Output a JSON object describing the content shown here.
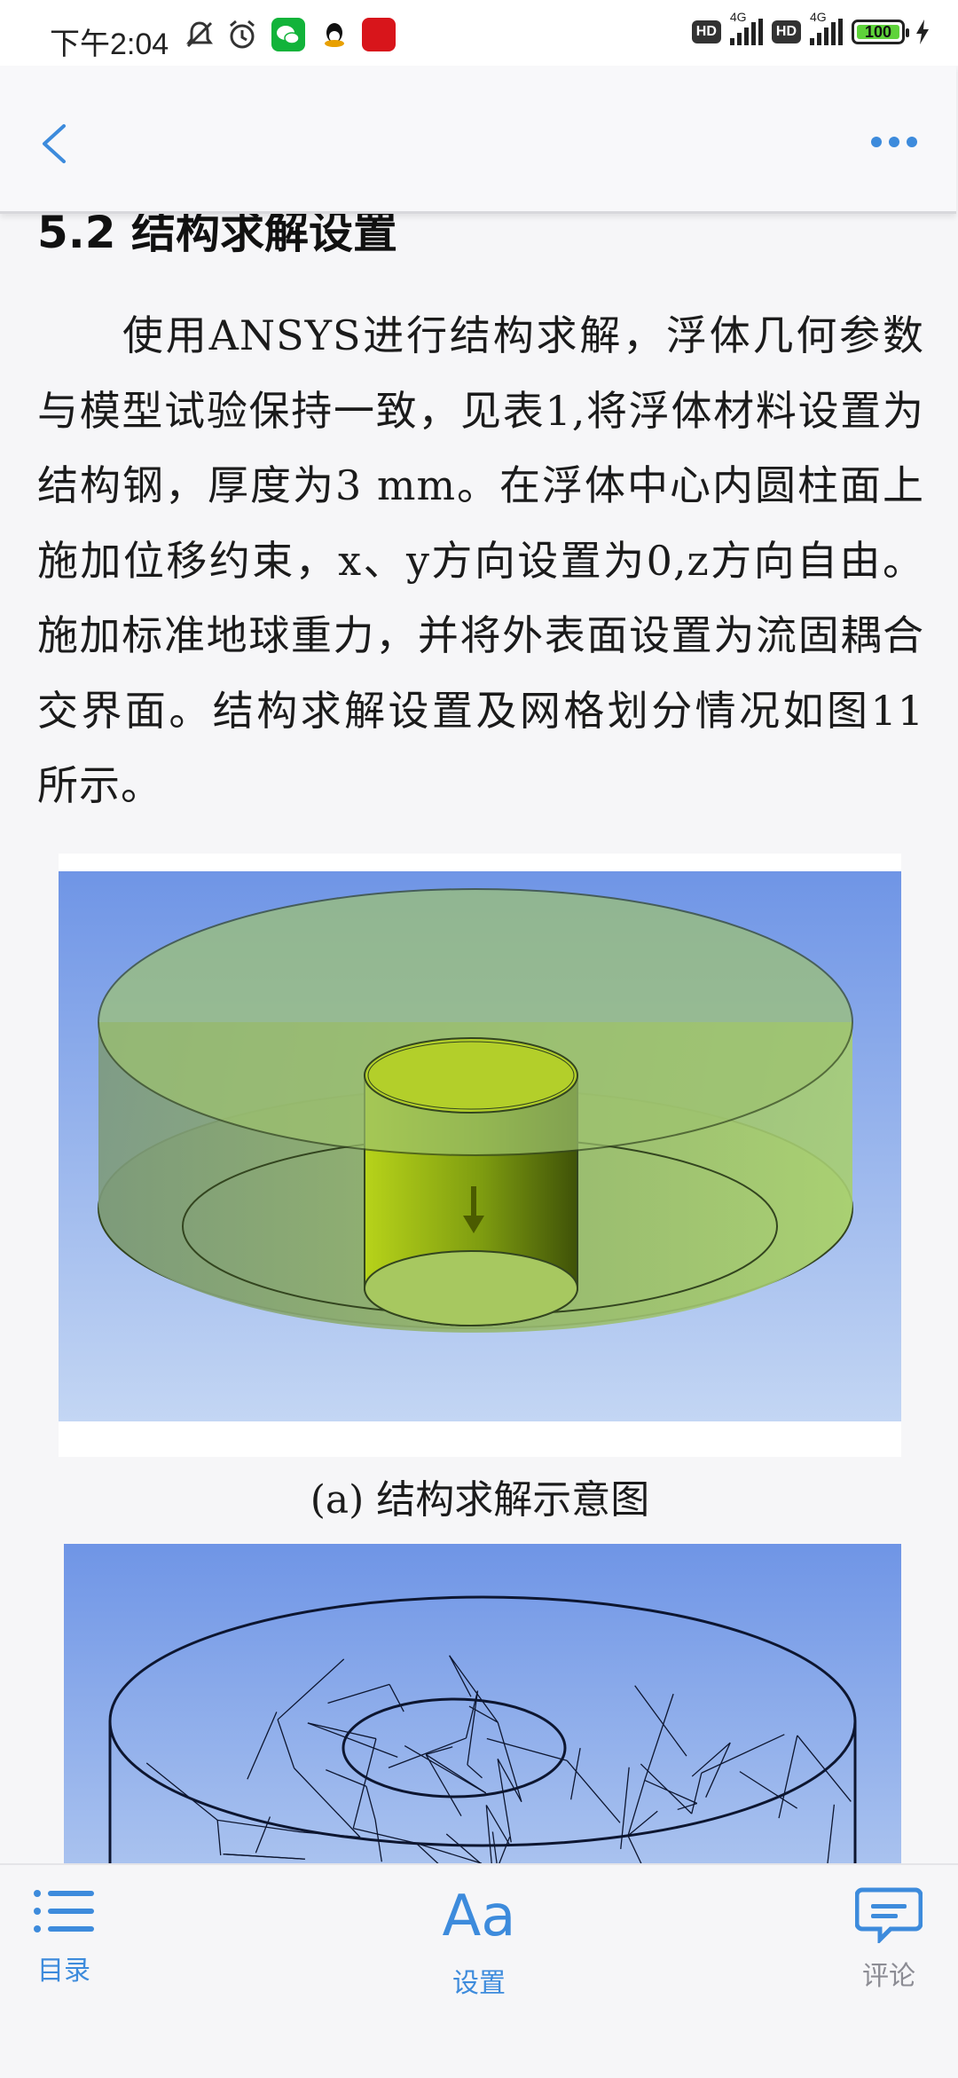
{
  "status_bar": {
    "time": "下午2:04",
    "network_1": "4G",
    "network_2": "4G",
    "hd_1": "HD",
    "hd_2": "HD",
    "battery": "100"
  },
  "nav": {
    "back_icon": "chevron-left-icon",
    "more_icon": "more-horizontal-icon",
    "accent_color": "#3d8bdc"
  },
  "article": {
    "section_heading": "5.2 结构求解设置",
    "paragraph": "使用ANSYS进行结构求解，浮体几何参数与模型试验保持一致，见表1,将浮体材料设置为结构钢，厚度为3 mm。在浮体中心内圆柱面上施加位移约束，x、y方向设置为0,z方向自由。施加标准地球重力，并将外表面设置为流固耦合交界面。结构求解设置及网格划分情况如图11所示。",
    "figure_a_caption": "(a) 结构求解示意图"
  },
  "bottom_bar": {
    "toc_label": "目录",
    "settings_icon_text": "Aa",
    "settings_label": "设置",
    "comment_label": "评论"
  }
}
